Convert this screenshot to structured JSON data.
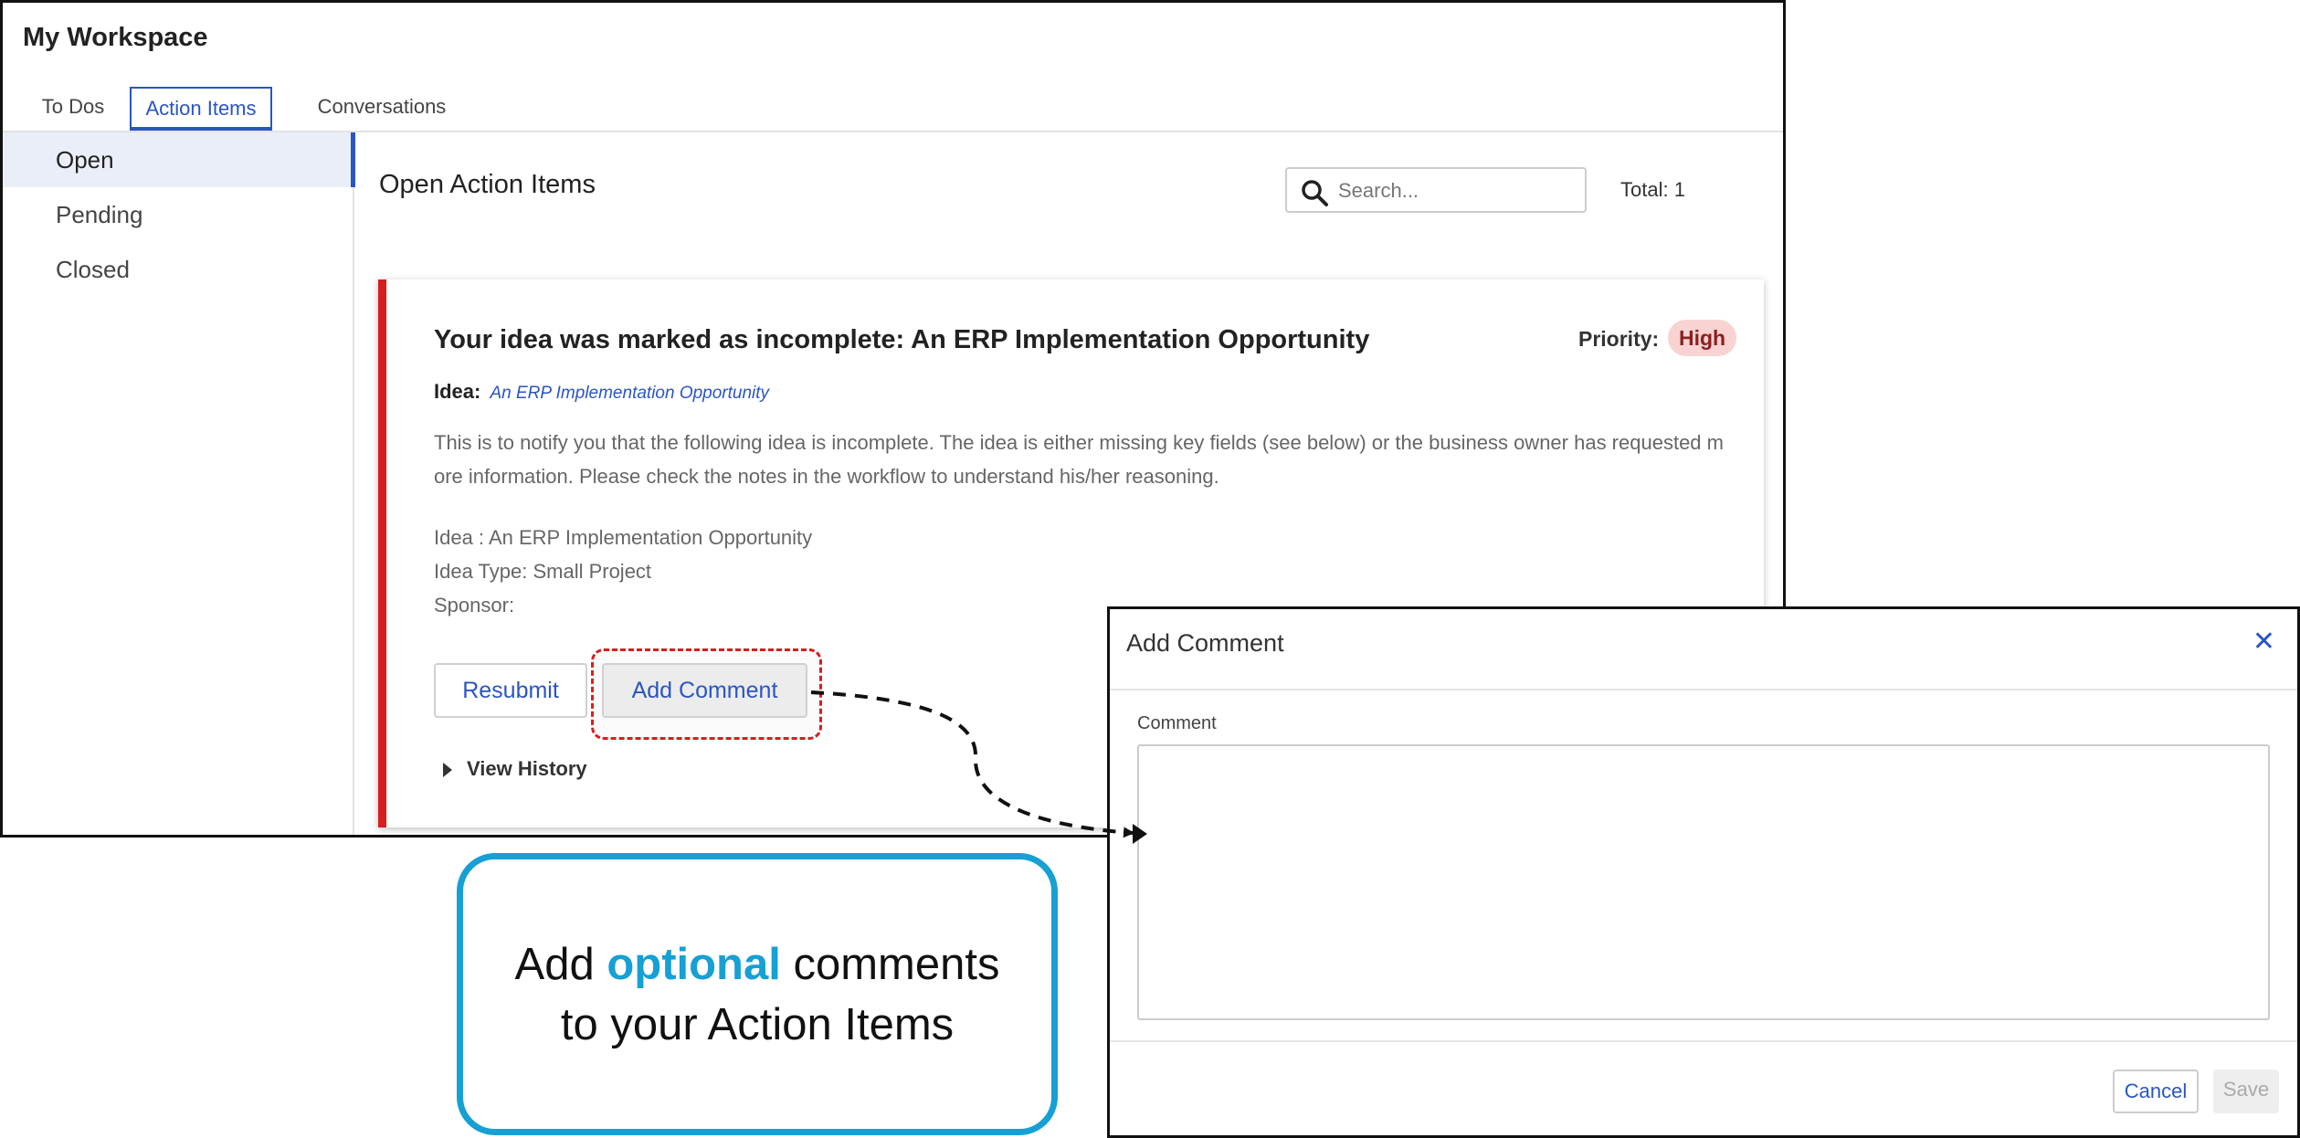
{
  "workspace": {
    "title": "My Workspace",
    "tabs": [
      {
        "label": "To Dos"
      },
      {
        "label": "Action Items",
        "active": true
      },
      {
        "label": "Conversations"
      }
    ],
    "sidebar": {
      "items": [
        {
          "label": "Open",
          "selected": true
        },
        {
          "label": "Pending"
        },
        {
          "label": "Closed"
        }
      ]
    },
    "main": {
      "title": "Open Action Items",
      "search_placeholder": "Search...",
      "total": "Total: 1"
    }
  },
  "card": {
    "title": "Your idea was marked as incomplete: An ERP Implementation Opportunity",
    "priority_label": "Priority:",
    "priority_value": "High",
    "idea_label": "Idea:",
    "idea_link": "An ERP Implementation Opportunity",
    "description": "This is to notify you that the following idea is incomplete. The idea is either missing key fields (see below) or the business owner has requested more information. Please check the notes in the workflow to understand his/her reasoning.",
    "details": {
      "idea": "Idea : An ERP Implementation Opportunity",
      "type": "Idea Type: Small Project",
      "sponsor": "Sponsor:"
    },
    "buttons": {
      "resubmit": "Resubmit",
      "add_comment": "Add Comment"
    },
    "view_history": "View History"
  },
  "callout": {
    "before": "Add ",
    "accent": "optional",
    "after": " comments",
    "line2": "to your Action Items"
  },
  "modal": {
    "title": "Add Comment",
    "close_icon": "close-icon",
    "comment_label": "Comment",
    "comment_value": "",
    "cancel": "Cancel",
    "save": "Save"
  },
  "colors": {
    "accent": "#2a55c4",
    "priority_bar": "#d61f1f",
    "callout": "#16a0d4"
  }
}
